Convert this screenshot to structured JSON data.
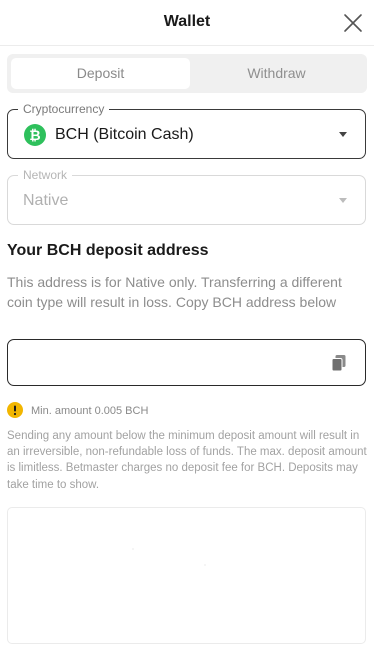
{
  "header": {
    "title": "Wallet"
  },
  "tabs": [
    {
      "label": "Deposit",
      "active": true
    },
    {
      "label": "Withdraw",
      "active": false
    }
  ],
  "cryptocurrency": {
    "legend": "Cryptocurrency",
    "value": "BCH (Bitcoin Cash)",
    "icon": "bitcoin-cash-icon",
    "icon_color": "#2ec05c"
  },
  "network": {
    "legend": "Network",
    "value": "Native",
    "disabled": true
  },
  "deposit": {
    "title": "Your BCH deposit address",
    "description": "This address is for Native only. Transferring a different coin type will result in loss. Copy BCH address below",
    "address": ""
  },
  "min_amount": {
    "text": "Min. amount 0.005 BCH",
    "icon_color": "#f2b600"
  },
  "notice": "Sending any amount below the minimum deposit amount will result in an irreversible, non-refundable loss of funds. The max. deposit amount is limitless. Betmaster charges no deposit fee for BCH. Deposits may take time to show."
}
